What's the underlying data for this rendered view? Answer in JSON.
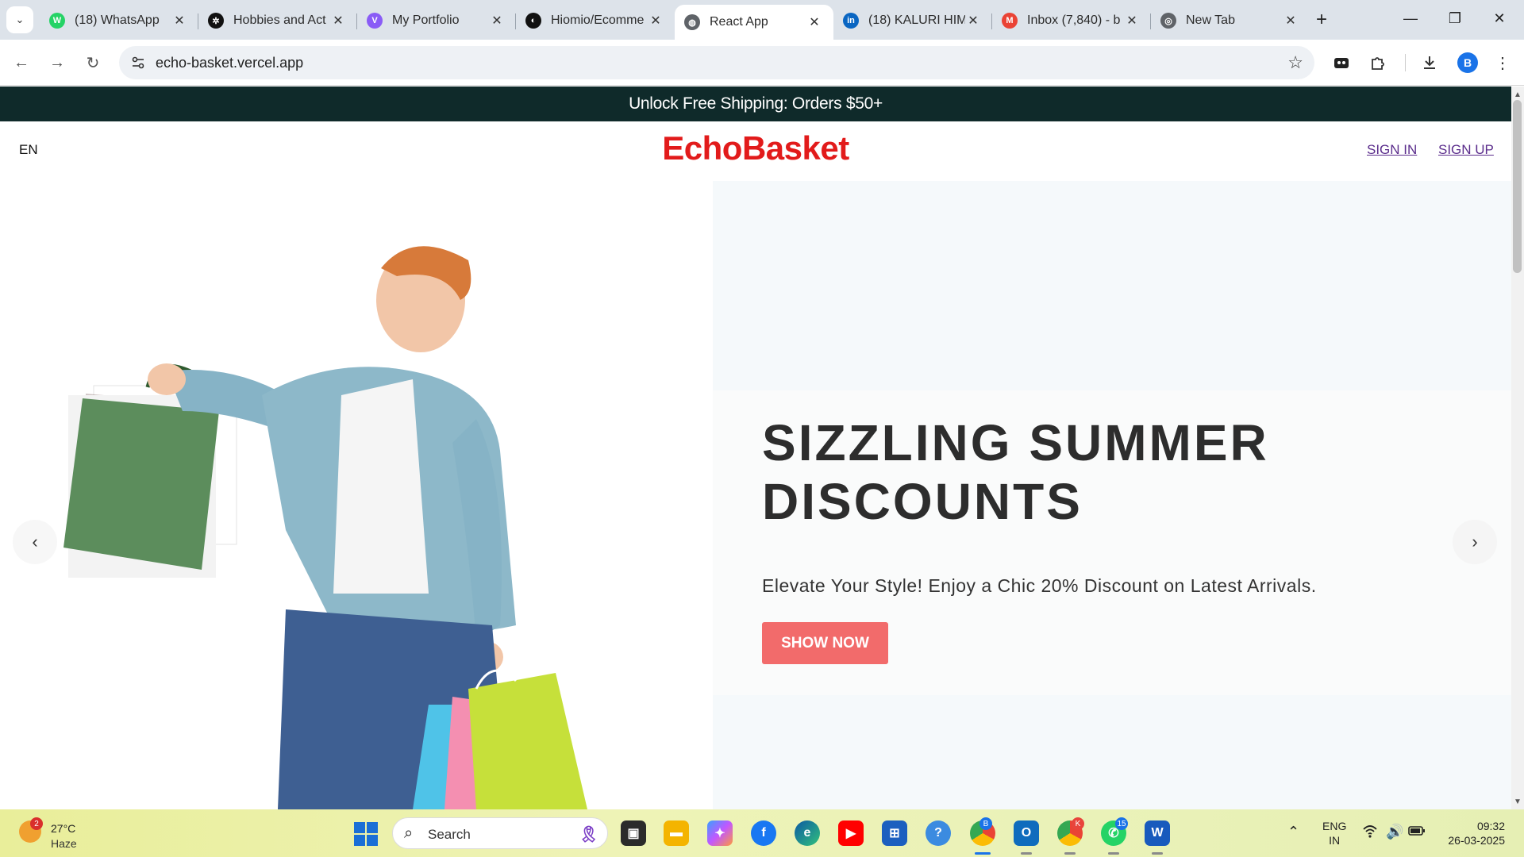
{
  "browser": {
    "tabs": [
      {
        "title": "(18) WhatsApp",
        "icon": "whatsapp-icon",
        "color": "#25d366",
        "glyph": "W"
      },
      {
        "title": "Hobbies and Act",
        "icon": "chatgpt-icon",
        "color": "#111111",
        "glyph": "✲"
      },
      {
        "title": "My Portfolio",
        "icon": "vite-icon",
        "color": "#8a5cf6",
        "glyph": "V"
      },
      {
        "title": "Hiomio/Ecomme",
        "icon": "github-icon",
        "color": "#111111",
        "glyph": "◐"
      },
      {
        "title": "React App",
        "icon": "globe-icon",
        "color": "#5f6368",
        "glyph": "◍"
      },
      {
        "title": "(18) KALURI HIM",
        "icon": "linkedin-icon",
        "color": "#0a66c2",
        "glyph": "in"
      },
      {
        "title": "Inbox (7,840) - b",
        "icon": "gmail-icon",
        "color": "#ea4335",
        "glyph": "M"
      },
      {
        "title": "New Tab",
        "icon": "chrome-icon",
        "color": "#5f6368",
        "glyph": "◎"
      }
    ],
    "url": "echo-basket.vercel.app",
    "profile_initial": "B"
  },
  "page": {
    "promo": "Unlock Free Shipping: Orders $50+",
    "lang": "EN",
    "logo": "EchoBasket",
    "sign_in": "SIGN IN",
    "sign_up": "SIGN UP",
    "hero": {
      "headline": "SIZZLING SUMMER DISCOUNTS",
      "subline": "Elevate Your Style! Enjoy a Chic 20% Discount on Latest Arrivals.",
      "cta": "SHOW NOW"
    }
  },
  "taskbar": {
    "weather": {
      "temp": "27°C",
      "cond": "Haze",
      "badge": "2"
    },
    "search_placeholder": "Search",
    "lang": "ENG",
    "region": "IN",
    "time": "09:32",
    "date": "26-03-2025",
    "chrome_badge_b": "B",
    "chrome_badge_k": "K",
    "whatsapp_badge": "15"
  }
}
